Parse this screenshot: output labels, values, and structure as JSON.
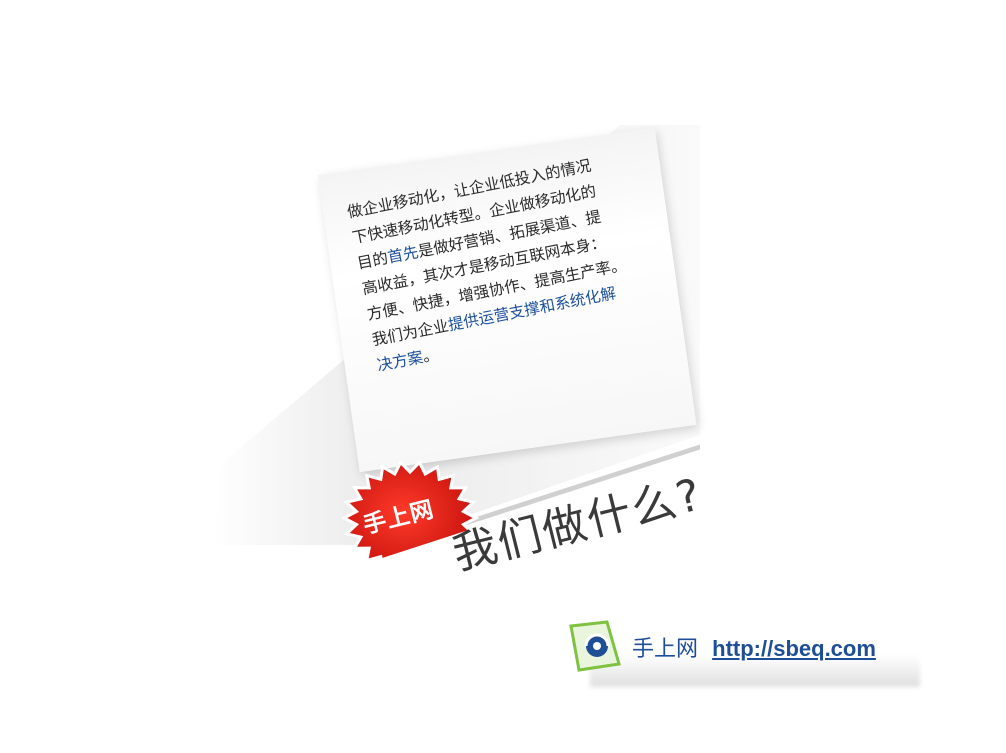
{
  "card": {
    "lines": [
      [
        {
          "t": "做企业移动化，让企业低投入的情况",
          "c": ""
        }
      ],
      [
        {
          "t": "下快速移动化转型。企业做移动化的",
          "c": ""
        }
      ],
      [
        {
          "t": "目的",
          "c": ""
        },
        {
          "t": "首先",
          "c": "blue"
        },
        {
          "t": "是做好营销、拓展渠道、提",
          "c": ""
        }
      ],
      [
        {
          "t": "高收益，其次才是移动互联网本身：",
          "c": ""
        }
      ],
      [
        {
          "t": "方便、快捷，增强协作、提高生产率。",
          "c": ""
        }
      ],
      [
        {
          "t": "我们为企业",
          "c": ""
        },
        {
          "t": "提供运营支撑和系统化解",
          "c": "blue"
        }
      ],
      [
        {
          "t": "决方案",
          "c": "blue"
        },
        {
          "t": "。",
          "c": ""
        }
      ]
    ]
  },
  "badge": {
    "label": "手上网"
  },
  "headline": {
    "text": "我们做什么?"
  },
  "footer": {
    "site_name": "手上网",
    "url": "http://sbeq.com"
  },
  "colors": {
    "badge_red": "#e8231b",
    "link_blue": "#1e4f96",
    "logo_green": "#7fc241"
  }
}
